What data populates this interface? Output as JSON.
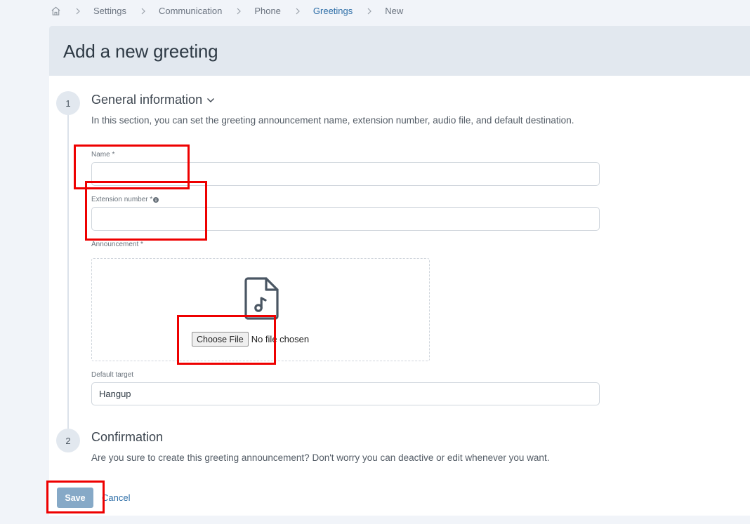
{
  "breadcrumb": {
    "items": [
      {
        "label": "Settings"
      },
      {
        "label": "Communication"
      },
      {
        "label": "Phone"
      },
      {
        "label": "Greetings"
      },
      {
        "label": "New"
      }
    ]
  },
  "page": {
    "title": "Add a new greeting"
  },
  "steps": [
    {
      "number": "1",
      "title": "General information",
      "description": "In this section, you can set the greeting announcement name, extension number, audio file, and default destination."
    },
    {
      "number": "2",
      "title": "Confirmation",
      "description": "Are you sure to create this greeting announcement? Don't worry you can deactive or edit whenever you want."
    }
  ],
  "form": {
    "name": {
      "label": "Name *",
      "value": ""
    },
    "extension": {
      "label": "Extension number *",
      "value": ""
    },
    "announcement": {
      "label": "Announcement *",
      "choose_label": "Choose File",
      "status": "No file chosen",
      "icon": "music-file-icon"
    },
    "default_target": {
      "label": "Default target",
      "value": "Hangup"
    }
  },
  "actions": {
    "save": "Save",
    "cancel": "Cancel"
  },
  "colors": {
    "accent": "#2f6fa8",
    "save_button": "#86a9c7",
    "header_band": "#e2e8ef",
    "annotation_red": "#ee0000"
  }
}
